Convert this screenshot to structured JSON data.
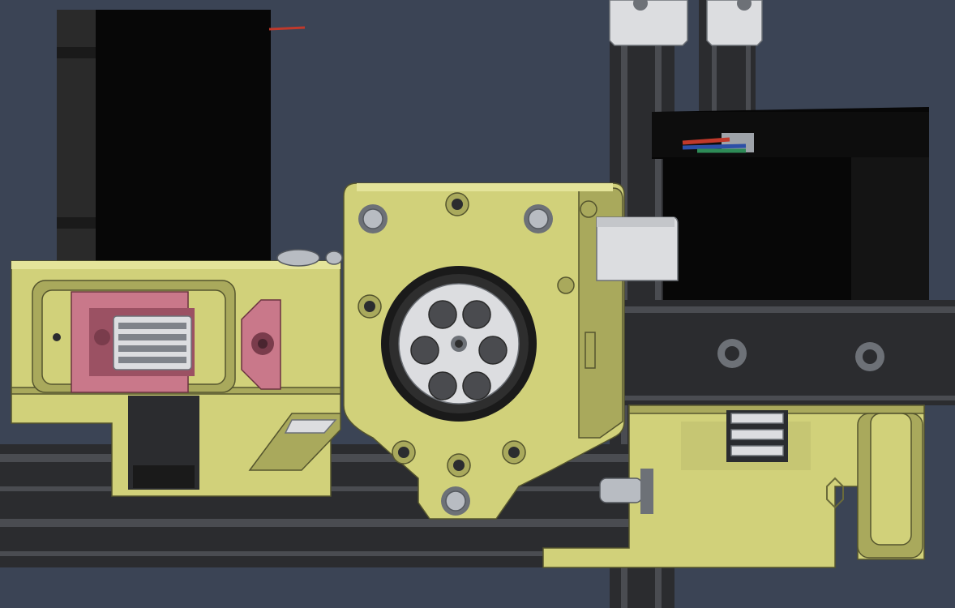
{
  "scene": {
    "background": "#3b4455",
    "palette": {
      "printed_part": "#d1d17a",
      "printed_part_light": "#e4e49a",
      "printed_part_dark": "#a9a95c",
      "motor_black": "#070707",
      "motor_edge": "#2a2a2a",
      "extrusion": "#2b2c2f",
      "extrusion_light": "#4a4c51",
      "pink_part": "#c9788a",
      "metal": "#b8bcc2",
      "metal_dark": "#6d7177",
      "white_part": "#dcdde0",
      "cable_red": "#c0392b",
      "cable_green": "#2e8b57",
      "cable_blue": "#2c4fa6"
    }
  }
}
